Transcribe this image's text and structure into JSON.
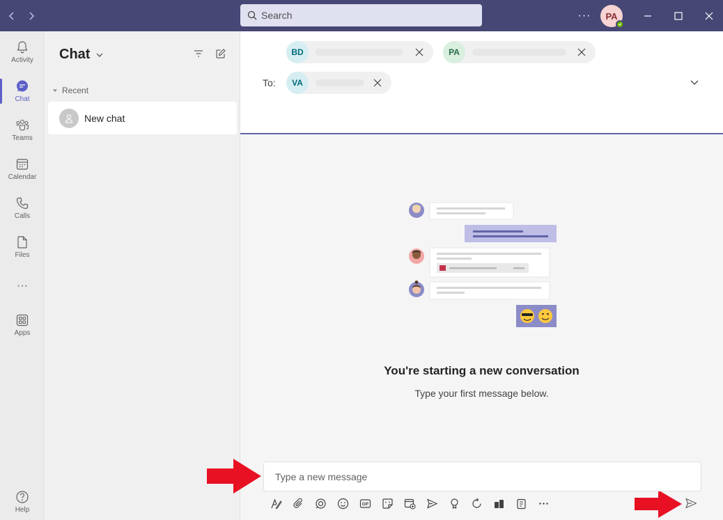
{
  "titlebar": {
    "search_placeholder": "Search",
    "user_initials": "PA",
    "more_label": "···"
  },
  "rail": {
    "items": [
      {
        "label": "Activity",
        "icon": "bell-icon"
      },
      {
        "label": "Chat",
        "icon": "chat-icon",
        "active": true
      },
      {
        "label": "Teams",
        "icon": "teams-icon"
      },
      {
        "label": "Calendar",
        "icon": "calendar-icon"
      },
      {
        "label": "Calls",
        "icon": "phone-icon"
      },
      {
        "label": "Files",
        "icon": "file-icon"
      },
      {
        "label": "···",
        "icon": "more-icon"
      },
      {
        "label": "Apps",
        "icon": "apps-icon"
      },
      {
        "label": "Help",
        "icon": "help-icon"
      }
    ]
  },
  "chatlist": {
    "title": "Chat",
    "section_header": "Recent",
    "items": [
      {
        "label": "New chat"
      }
    ]
  },
  "to_field": {
    "label": "To:",
    "recipients": [
      {
        "initials": "BD",
        "bg": "#d6eef2",
        "fg": "#036a7d"
      },
      {
        "initials": "PA",
        "bg": "#d9efe0",
        "fg": "#276b45"
      },
      {
        "initials": "VA",
        "bg": "#d6eef2",
        "fg": "#036a7d"
      }
    ]
  },
  "empty_state": {
    "title": "You're starting a new conversation",
    "subtitle": "Type your first message below."
  },
  "composer": {
    "placeholder": "Type a new message"
  },
  "colors": {
    "titlebar": "#464775",
    "accent": "#5b5fc7",
    "arrow_red": "#e81123"
  }
}
